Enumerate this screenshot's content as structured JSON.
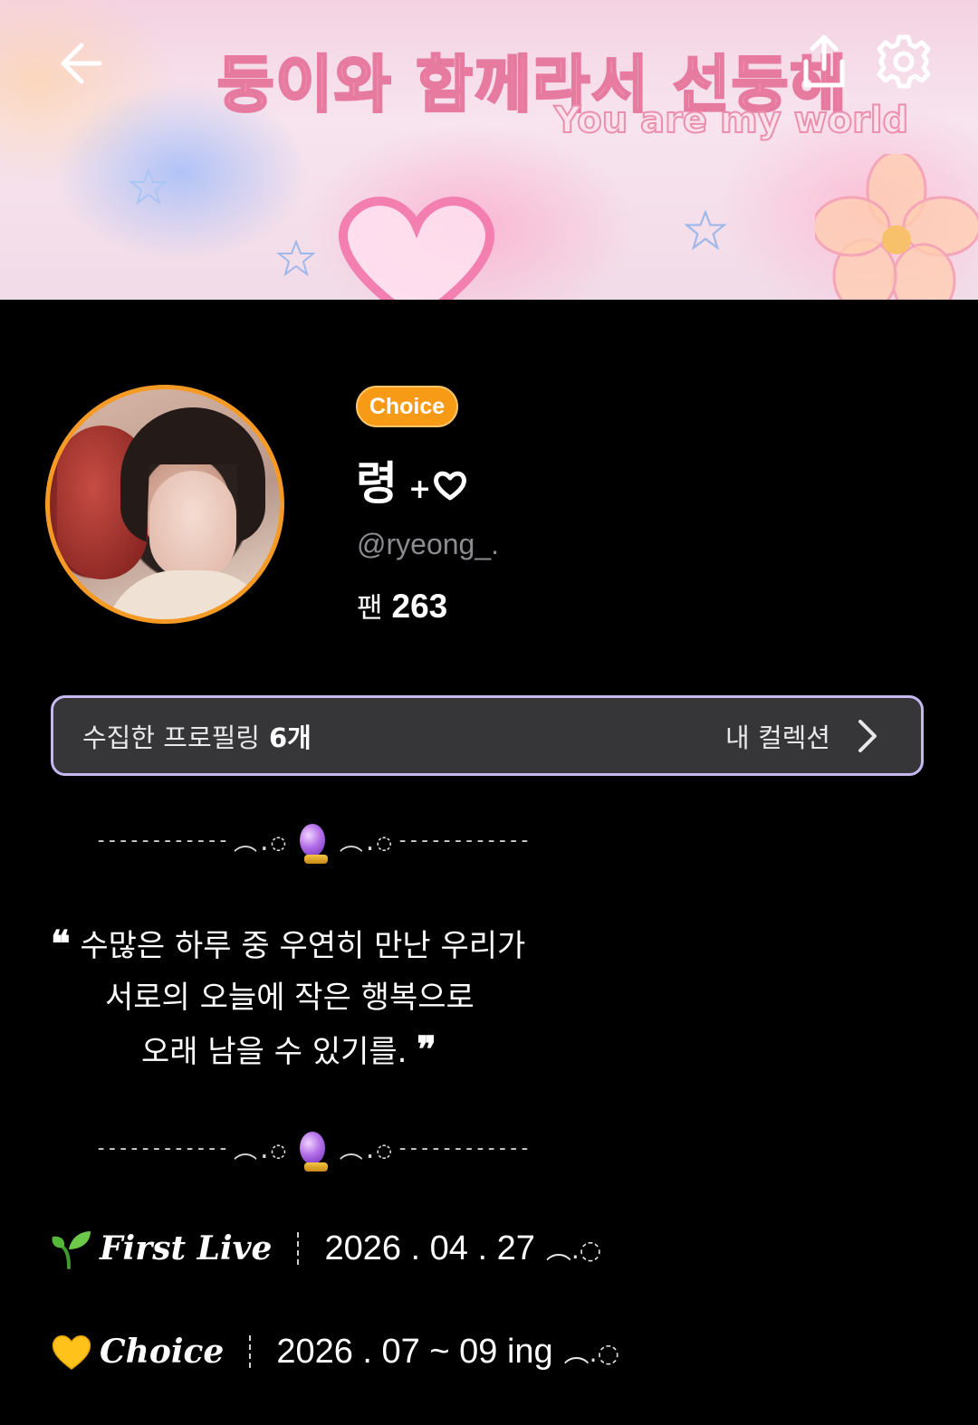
{
  "banner": {
    "title": "둥이와 함께라서 선둥해",
    "subtitle": "You are my world"
  },
  "nav": {
    "back_icon": "arrow-left-icon",
    "share_icon": "share-icon",
    "settings_icon": "gear-icon"
  },
  "profile": {
    "badge": "Choice",
    "name": "령",
    "name_suffix_plus": "+",
    "name_suffix_icon": "heart-icon",
    "handle": "@ryeong_.",
    "fans_label": "팬",
    "fans_count": "263",
    "avatar_border_color": "#f59a24",
    "badge_color": "#f79a16"
  },
  "collection": {
    "label": "수집한 프로필링",
    "count": "6개",
    "link": "내 컬렉션",
    "border_color": "#c7b8f2"
  },
  "bio": {
    "divider_dashes": "------------",
    "divider_wave": "︵.◌",
    "divider_icon": "crystal-ball-icon",
    "open_quote": "❝",
    "close_quote": "❞",
    "line1": "수많은 하루 중 우연히 만난 우리가",
    "line2": "서로의 오늘에 작은 행복으로",
    "line3": "오래 남을 수 있기를."
  },
  "info": [
    {
      "icon": "seedling-icon",
      "label": "First Live",
      "value": "2026 . 04 . 27",
      "wave": "︵.◌"
    },
    {
      "icon": "yellow-heart-icon",
      "label": "Choice",
      "value": "2026 . 07 ~ 09 ing",
      "wave": "︵.◌"
    }
  ]
}
